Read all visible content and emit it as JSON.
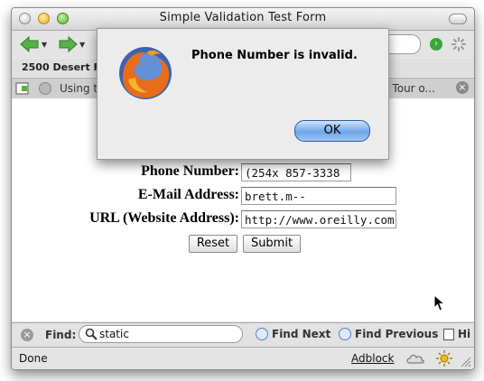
{
  "window": {
    "title": "Simple Validation Test Form"
  },
  "bookmarks": {
    "item_1": "2500 Desert Fa"
  },
  "tabs": [
    {
      "label": "Using t"
    },
    {
      "label": "g Tour o..."
    }
  ],
  "form": {
    "phone": {
      "label": "Phone Number:",
      "value": "(254x 857-3338"
    },
    "email": {
      "label": "E-Mail Address:",
      "value": "brett.m--"
    },
    "url": {
      "label": "URL (Website Address):",
      "value": "http://www.oreilly.com"
    },
    "reset_label": "Reset",
    "submit_label": "Submit"
  },
  "find_bar": {
    "label": "Find:",
    "query": "static",
    "find_next": "Find Next",
    "find_previous": "Find Previous",
    "highlight": "Hi"
  },
  "status_bar": {
    "text": "Done",
    "adblock": "Adblock"
  },
  "dialog": {
    "message": "Phone Number is invalid.",
    "ok_label": "OK"
  },
  "colors": {
    "accent_button": "#6ea6ea",
    "nav_arrow": "#58b04a"
  }
}
